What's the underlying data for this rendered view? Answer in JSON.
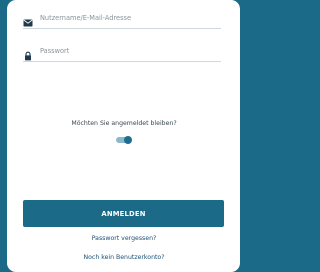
{
  "login_form": {
    "username_placeholder": "Nutzername/E-Mail-Adresse",
    "password_placeholder": "Passwort",
    "username_icon": "mail-icon",
    "password_icon": "lock-icon",
    "remember_label": "Möchten Sie angemeldet bleiben?",
    "remember_enabled": true,
    "login_button_label": "ANMELDEN",
    "forgot_password_link": "Passwort vergessen?",
    "register_link": "Noch kein Benutzerkonto?"
  },
  "colors": {
    "background": "#1a6a88",
    "button": "#1a6a88",
    "link": "#1a4f73",
    "toggle_thumb": "#1f6e8f",
    "toggle_track": "#8bb8cc"
  }
}
